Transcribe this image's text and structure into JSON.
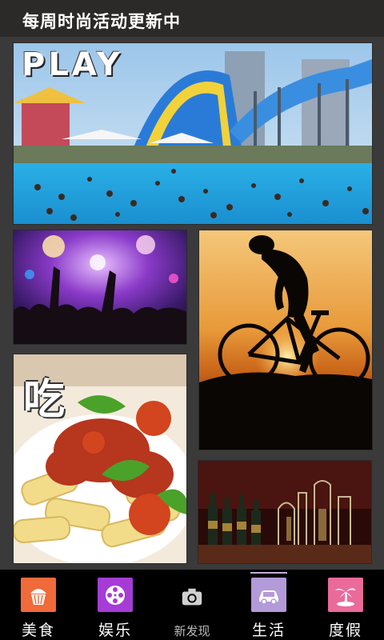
{
  "header": {
    "title": "每周时尚活动更新中"
  },
  "tiles": {
    "play": {
      "overlay": "PLAY"
    },
    "food": {
      "overlay": "吃"
    }
  },
  "tabs": [
    {
      "label": "美食",
      "icon": "cupcake-icon",
      "color": "#f06a3a"
    },
    {
      "label": "娱乐",
      "icon": "film-reel-icon",
      "color": "#a53cd6"
    },
    {
      "label": "新发现",
      "icon": "camera-icon",
      "color": "#000000"
    },
    {
      "label": "生活",
      "icon": "car-icon",
      "color": "#b39ad8",
      "active": true
    },
    {
      "label": "度假",
      "icon": "palm-island-icon",
      "color": "#ea6a9a"
    }
  ]
}
